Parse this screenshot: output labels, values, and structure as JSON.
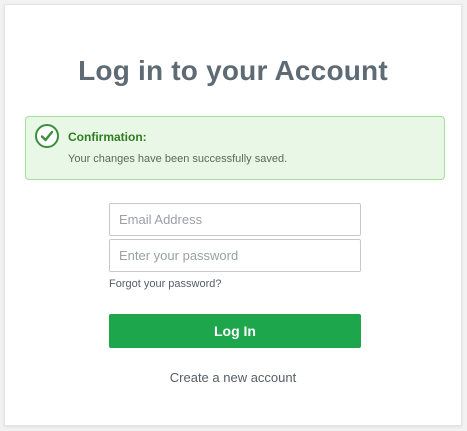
{
  "login": {
    "title": "Log in to your Account",
    "alert": {
      "title": "Confirmation:",
      "message": "Your changes have been successfully saved.",
      "icon": "check-circle-icon"
    },
    "email_placeholder": "Email Address",
    "password_placeholder": "Enter your password",
    "forgot_label": "Forgot your password?",
    "button_label": "Log In",
    "create_label": "Create a new account"
  },
  "colors": {
    "title": "#5f6b74",
    "alert_bg": "#e9f7e7",
    "alert_border": "#a9dca0",
    "success": "#2f7d1f",
    "button": "#1ea64c"
  }
}
